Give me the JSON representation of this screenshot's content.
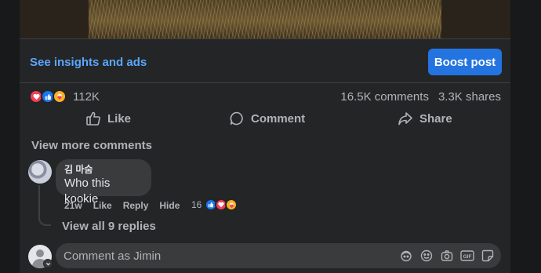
{
  "insights": {
    "link_label": "See insights and ads",
    "boost_label": "Boost post"
  },
  "reactions": {
    "types": [
      "love-icon",
      "like-icon",
      "care-icon"
    ],
    "count": "112K",
    "comments": "16.5K comments",
    "shares": "3.3K shares"
  },
  "actions": {
    "like": "Like",
    "comment": "Comment",
    "share": "Share"
  },
  "comments": {
    "view_more": "View more comments",
    "items": [
      {
        "author": "김 마숨",
        "text": "Who this kookie",
        "time": "21w",
        "like": "Like",
        "reply": "Reply",
        "hide": "Hide",
        "reaction_count": "16",
        "view_replies": "View all 9 replies"
      }
    ]
  },
  "composer": {
    "placeholder": "Comment as Jimin",
    "tools": [
      "avatar-sticker-icon",
      "emoji-icon",
      "camera-icon",
      "gif-icon",
      "sticker-icon"
    ]
  },
  "colors": {
    "accent": "#2374e1",
    "link": "#5aa7ff",
    "love": "#f33e58",
    "like": "#1877f2",
    "care": "#f7b125"
  }
}
